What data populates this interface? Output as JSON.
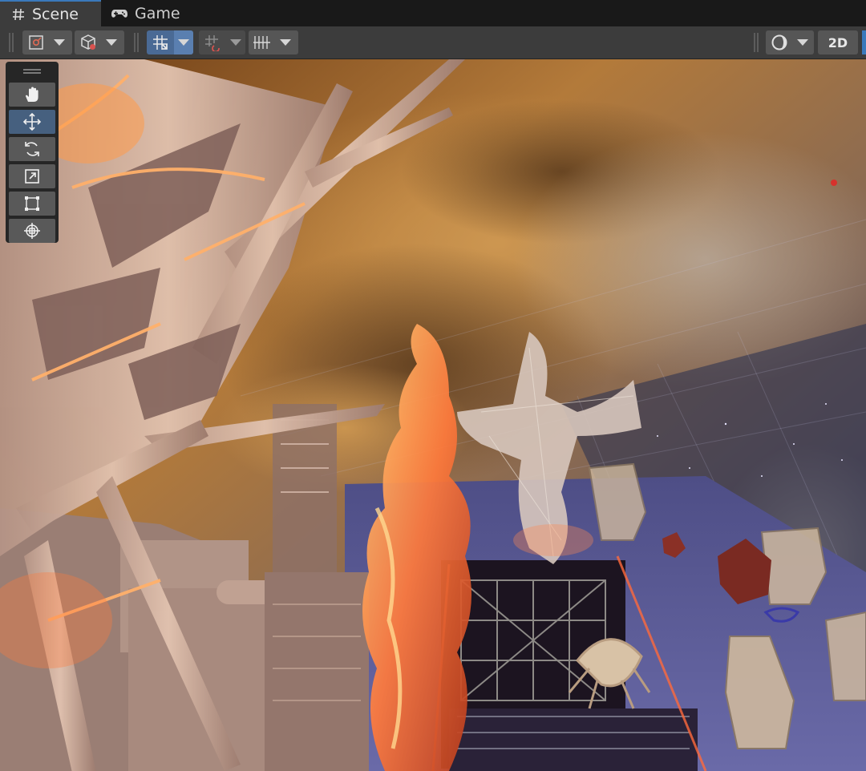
{
  "tabs": [
    {
      "label": "Scene",
      "icon": "hash-icon",
      "active": true
    },
    {
      "label": "Game",
      "icon": "gamepad-icon",
      "active": false
    }
  ],
  "toolbar": {
    "left_buttons": [
      {
        "name": "draw-mode-icon"
      },
      {
        "name": "render-mode-cube-icon"
      },
      {
        "name": "grid-snap-icon",
        "active": true
      },
      {
        "name": "increment-snap-icon"
      },
      {
        "name": "grid-visibility-icon"
      }
    ],
    "right_buttons": [
      {
        "name": "shading-sphere-icon"
      }
    ],
    "mode_2d_label": "2D"
  },
  "tools": [
    {
      "name": "hand-tool",
      "icon": "hand-icon",
      "active": false
    },
    {
      "name": "move-tool",
      "icon": "move-arrows-icon",
      "active": true
    },
    {
      "name": "rotate-tool",
      "icon": "rotate-icon",
      "active": false
    },
    {
      "name": "scale-tool",
      "icon": "scale-icon",
      "active": false
    },
    {
      "name": "rect-tool",
      "icon": "rect-transform-icon",
      "active": false
    },
    {
      "name": "transform-tool",
      "icon": "transform-icon",
      "active": false
    }
  ],
  "colors": {
    "accent": "#3a79bb",
    "toolbar_bg": "#3c3c3c",
    "button_bg": "#565656",
    "active_button_bg": "#4a6a95",
    "sky_orange": "#b97a33",
    "sky_blue": "#4a4f6a",
    "glow": "#ff7a3c"
  }
}
